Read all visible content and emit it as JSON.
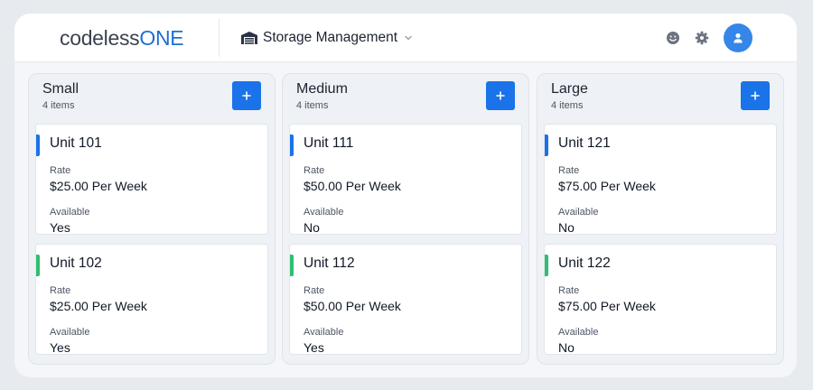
{
  "header": {
    "logo_prefix": "codeless",
    "logo_suffix": "ONE",
    "app_title": "Storage Management",
    "app_icon": "warehouse-icon",
    "icons": [
      "smiley-icon",
      "gear-icon",
      "user-icon"
    ]
  },
  "colors": {
    "accent": "#1a73e8",
    "bar_blue": "#1a73e8",
    "bar_green": "#2fbf71",
    "logo_blue": "#1f6fd1"
  },
  "columns": [
    {
      "title": "Small",
      "count": "4 items",
      "cards": [
        {
          "name": "Unit 101",
          "rate_label": "Rate",
          "rate": "$25.00 Per Week",
          "avail_label": "Available",
          "available": "Yes",
          "bar": "blue"
        },
        {
          "name": "Unit 102",
          "rate_label": "Rate",
          "rate": "$25.00 Per Week",
          "avail_label": "Available",
          "available": "Yes",
          "bar": "green"
        }
      ]
    },
    {
      "title": "Medium",
      "count": "4 items",
      "cards": [
        {
          "name": "Unit 111",
          "rate_label": "Rate",
          "rate": "$50.00 Per Week",
          "avail_label": "Available",
          "available": "No",
          "bar": "blue"
        },
        {
          "name": "Unit 112",
          "rate_label": "Rate",
          "rate": "$50.00 Per Week",
          "avail_label": "Available",
          "available": "Yes",
          "bar": "green"
        }
      ]
    },
    {
      "title": "Large",
      "count": "4 items",
      "cards": [
        {
          "name": "Unit 121",
          "rate_label": "Rate",
          "rate": "$75.00 Per Week",
          "avail_label": "Available",
          "available": "No",
          "bar": "blue"
        },
        {
          "name": "Unit 122",
          "rate_label": "Rate",
          "rate": "$75.00 Per Week",
          "avail_label": "Available",
          "available": "No",
          "bar": "green"
        }
      ]
    }
  ]
}
